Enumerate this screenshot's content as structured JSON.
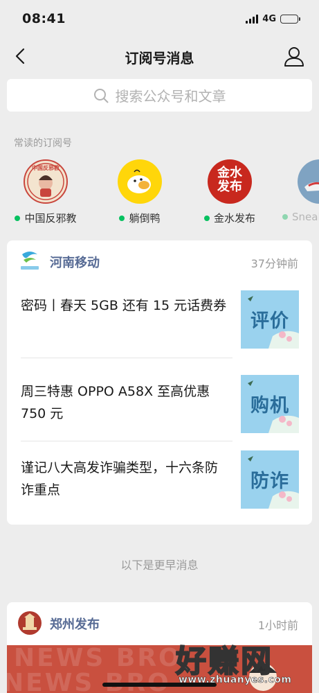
{
  "status_bar": {
    "time": "08:41",
    "network": "4G"
  },
  "nav": {
    "title": "订阅号消息"
  },
  "search": {
    "placeholder": "搜索公众号和文章"
  },
  "frequent": {
    "label": "常读的订阅号",
    "items": [
      {
        "name": "中国反邪教",
        "dot_color": "#07c160",
        "avatar_text": "中国反邪教"
      },
      {
        "name": "躺倒鸭",
        "dot_color": "#07c160",
        "avatar_text": ""
      },
      {
        "name": "金水发布",
        "dot_color": "#07c160",
        "avatar_text": "金水发布"
      },
      {
        "name": "Sneal",
        "dot_color": "#8fd6b0",
        "avatar_text": ""
      }
    ]
  },
  "feed_card_1": {
    "source": "河南移动",
    "time": "37分钟前",
    "articles": [
      {
        "title": "密码丨春天 5GB 还有 15 元话费券",
        "thumb_text": "评价"
      },
      {
        "title": "周三特惠 OPPO A58X 至高优惠 750 元",
        "thumb_text": "购机"
      },
      {
        "title": "谨记八大高发诈骗类型，十六条防诈重点",
        "thumb_text": "防诈"
      }
    ]
  },
  "earlier_label": "以下是更早消息",
  "feed_card_2": {
    "source": "郑州发布",
    "time": "1小时前"
  },
  "watermark": {
    "main": "好赚网",
    "sub": "www.zhuanyes.com"
  },
  "colors": {
    "accent_green": "#07c160",
    "link_blue": "#576b95",
    "background": "#ededed"
  }
}
